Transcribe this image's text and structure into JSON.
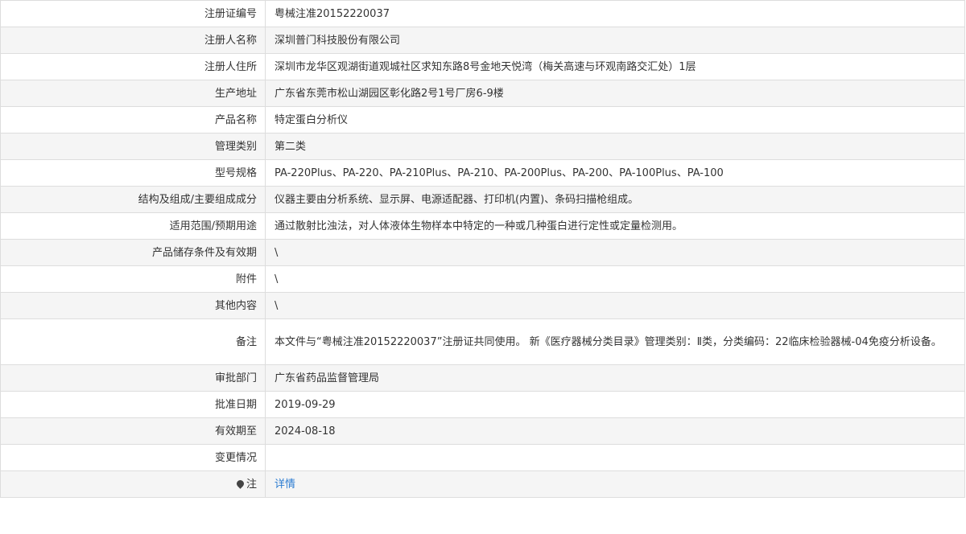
{
  "rows": [
    {
      "label": "注册证编号",
      "value": "粤械注准20152220037"
    },
    {
      "label": "注册人名称",
      "value": "深圳普门科技股份有限公司"
    },
    {
      "label": "注册人住所",
      "value": "深圳市龙华区观湖街道观城社区求知东路8号金地天悦湾（梅关高速与环观南路交汇处）1层"
    },
    {
      "label": "生产地址",
      "value": "广东省东莞市松山湖园区彰化路2号1号厂房6-9楼"
    },
    {
      "label": "产品名称",
      "value": "特定蛋白分析仪"
    },
    {
      "label": "管理类别",
      "value": "第二类"
    },
    {
      "label": "型号规格",
      "value": "PA-220Plus、PA-220、PA-210Plus、PA-210、PA-200Plus、PA-200、PA-100Plus、PA-100"
    },
    {
      "label": "结构及组成/主要组成成分",
      "value": "仪器主要由分析系统、显示屏、电源适配器、打印机(内置)、条码扫描枪组成。"
    },
    {
      "label": "适用范围/预期用途",
      "value": "通过散射比浊法，对人体液体生物样本中特定的一种或几种蛋白进行定性或定量检测用。"
    },
    {
      "label": "产品储存条件及有效期",
      "value": "\\"
    },
    {
      "label": "附件",
      "value": "\\"
    },
    {
      "label": "其他内容",
      "value": "\\"
    },
    {
      "label": "备注",
      "value": "本文件与“粤械注准20152220037”注册证共同使用。 新《医疗器械分类目录》管理类别：Ⅱ类，分类编码：22临床检验器械-04免疫分析设备。"
    },
    {
      "label": "审批部门",
      "value": "广东省药品监督管理局"
    },
    {
      "label": "批准日期",
      "value": "2019-09-29"
    },
    {
      "label": "有效期至",
      "value": "2024-08-18"
    },
    {
      "label": "变更情况",
      "value": ""
    }
  ],
  "note_row": {
    "icon": "pin-icon",
    "label": "注",
    "link_text": "详情"
  }
}
